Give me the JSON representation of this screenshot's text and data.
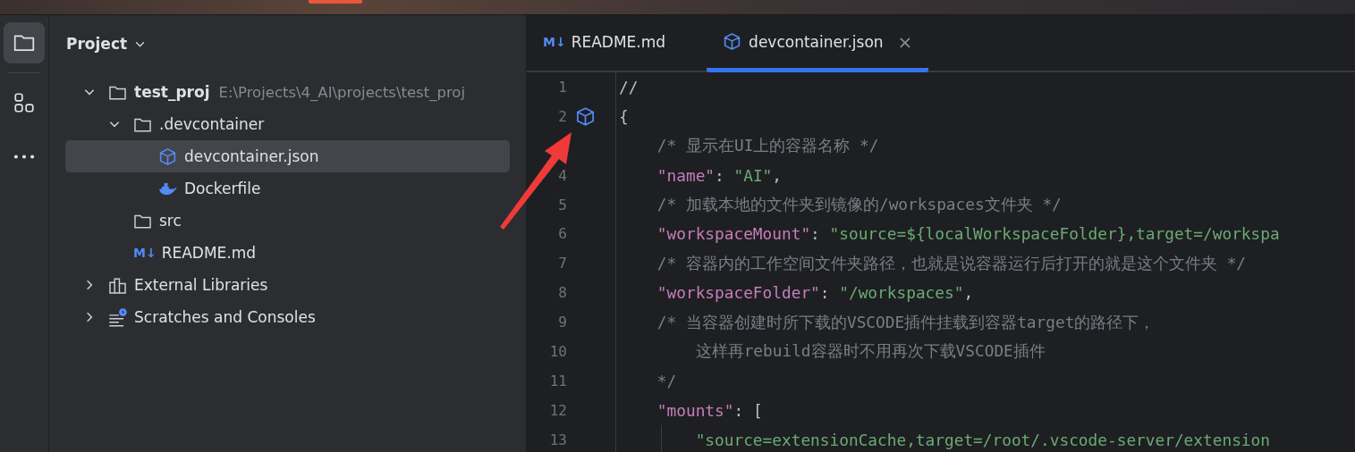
{
  "activity_bar": {
    "items": [
      {
        "kind": "folder",
        "selected": true
      },
      {
        "kind": "structure",
        "selected": false
      },
      {
        "kind": "more",
        "selected": false
      }
    ]
  },
  "project_panel": {
    "title": "Project",
    "tree": [
      {
        "name": "test_proj",
        "kind": "folder",
        "bold": true,
        "hint": "E:\\Projects\\4_AI\\projects\\test_proj",
        "expanded": true,
        "selected": false,
        "children": [
          {
            "name": ".devcontainer",
            "kind": "folder",
            "expanded": true,
            "selected": false,
            "children": [
              {
                "name": "devcontainer.json",
                "kind": "cube",
                "selected": true
              },
              {
                "name": "Dockerfile",
                "kind": "docker",
                "selected": false
              }
            ]
          },
          {
            "name": "src",
            "kind": "folder",
            "selected": false
          },
          {
            "name": "README.md",
            "kind": "markdown",
            "icon_text": "M↓",
            "selected": false
          }
        ]
      },
      {
        "name": "External Libraries",
        "kind": "library",
        "expanded": false,
        "selected": false
      },
      {
        "name": "Scratches and Consoles",
        "kind": "scratches",
        "expanded": false,
        "selected": false
      }
    ]
  },
  "editor": {
    "tabs": [
      {
        "label": "README.md",
        "kind": "markdown",
        "icon_text": "M↓",
        "selected": false,
        "closable": false
      },
      {
        "label": "devcontainer.json",
        "kind": "cube",
        "selected": true,
        "closable": true,
        "close_text": "×"
      }
    ],
    "lines": [
      {
        "number": "1",
        "tokens": [
          {
            "kind": "punct",
            "text": "//"
          }
        ]
      },
      {
        "number": "2",
        "gutter_marker": {
          "kind": "cube"
        },
        "tokens": [
          {
            "kind": "punct",
            "text": "{"
          }
        ]
      },
      {
        "tokens": [
          {
            "kind": "comment",
            "text": "    /* 显示在UI上的容器名称 */"
          }
        ]
      },
      {
        "number": "4",
        "tokens": [
          {
            "kind": "key",
            "text": "    \"name\""
          },
          {
            "kind": "punct",
            "text": ": "
          },
          {
            "kind": "string",
            "text": "\"AI\""
          },
          {
            "kind": "punct",
            "text": ","
          }
        ]
      },
      {
        "number": "5",
        "tokens": [
          {
            "kind": "comment",
            "text": "    /* 加载本地的文件夹到镜像的/workspaces文件夹 */"
          }
        ]
      },
      {
        "number": "6",
        "tokens": [
          {
            "kind": "key",
            "text": "    \"workspaceMount\""
          },
          {
            "kind": "punct",
            "text": ": "
          },
          {
            "kind": "string",
            "text": "\"source=${localWorkspaceFolder},target=/workspa"
          }
        ]
      },
      {
        "number": "7",
        "tokens": [
          {
            "kind": "comment",
            "text": "    /* 容器内的工作空间文件夹路径，也就是说容器运行后打开的就是这个文件夹 */"
          }
        ]
      },
      {
        "number": "8",
        "tokens": [
          {
            "kind": "key",
            "text": "    \"workspaceFolder\""
          },
          {
            "kind": "punct",
            "text": ": "
          },
          {
            "kind": "string",
            "text": "\"/workspaces\""
          },
          {
            "kind": "punct",
            "text": ","
          }
        ]
      },
      {
        "number": "9",
        "tokens": [
          {
            "kind": "comment",
            "text": "    /* 当容器创建时所下载的VSCODE插件挂载到容器target的路径下，"
          }
        ]
      },
      {
        "number": "10",
        "tokens": [
          {
            "kind": "comment",
            "text": "        这样再rebuild容器时不用再次下载VSCODE插件"
          }
        ]
      },
      {
        "number": "11",
        "tokens": [
          {
            "kind": "comment",
            "text": "    */"
          }
        ]
      },
      {
        "number": "12",
        "tokens": [
          {
            "kind": "key",
            "text": "    \"mounts\""
          },
          {
            "kind": "punct",
            "text": ": ["
          }
        ]
      },
      {
        "number": "13",
        "guide": true,
        "tokens": [
          {
            "kind": "string",
            "text": "        \"source=extensionCache,target=/root/.vscode-server/extension"
          }
        ]
      }
    ]
  },
  "annotation": {
    "kind": "arrow"
  }
}
